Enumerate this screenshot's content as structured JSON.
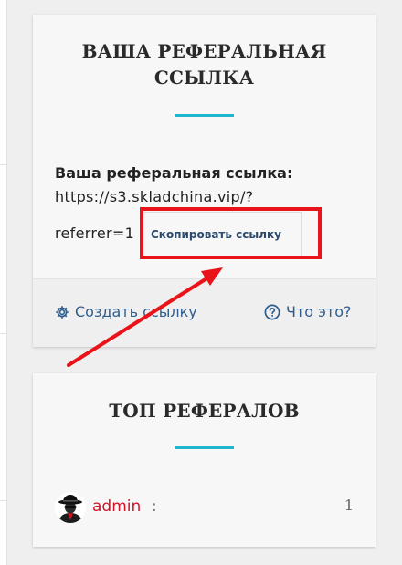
{
  "referral_card": {
    "title": "ВАША РЕФЕРАЛЬНАЯ ССЫЛКА",
    "label": "Ваша реферальная ссылка:",
    "url_line1": "https://s3.skladchina.vip/?",
    "url_line2": "referrer=1",
    "copy_button": "Скопировать ссылку",
    "create_link": "Создать ссылку",
    "what_is_it": "Что это?"
  },
  "top_card": {
    "title": "ТОП РЕФЕРАЛОВ",
    "rows": [
      {
        "name": "admin",
        "separator": ":",
        "count": "1",
        "avatar": "spy-avatar-icon"
      }
    ]
  },
  "colors": {
    "accent": "#1fb5cc",
    "link": "#2f5d8e",
    "username": "#d3122a",
    "annotation": "#e8141a"
  }
}
